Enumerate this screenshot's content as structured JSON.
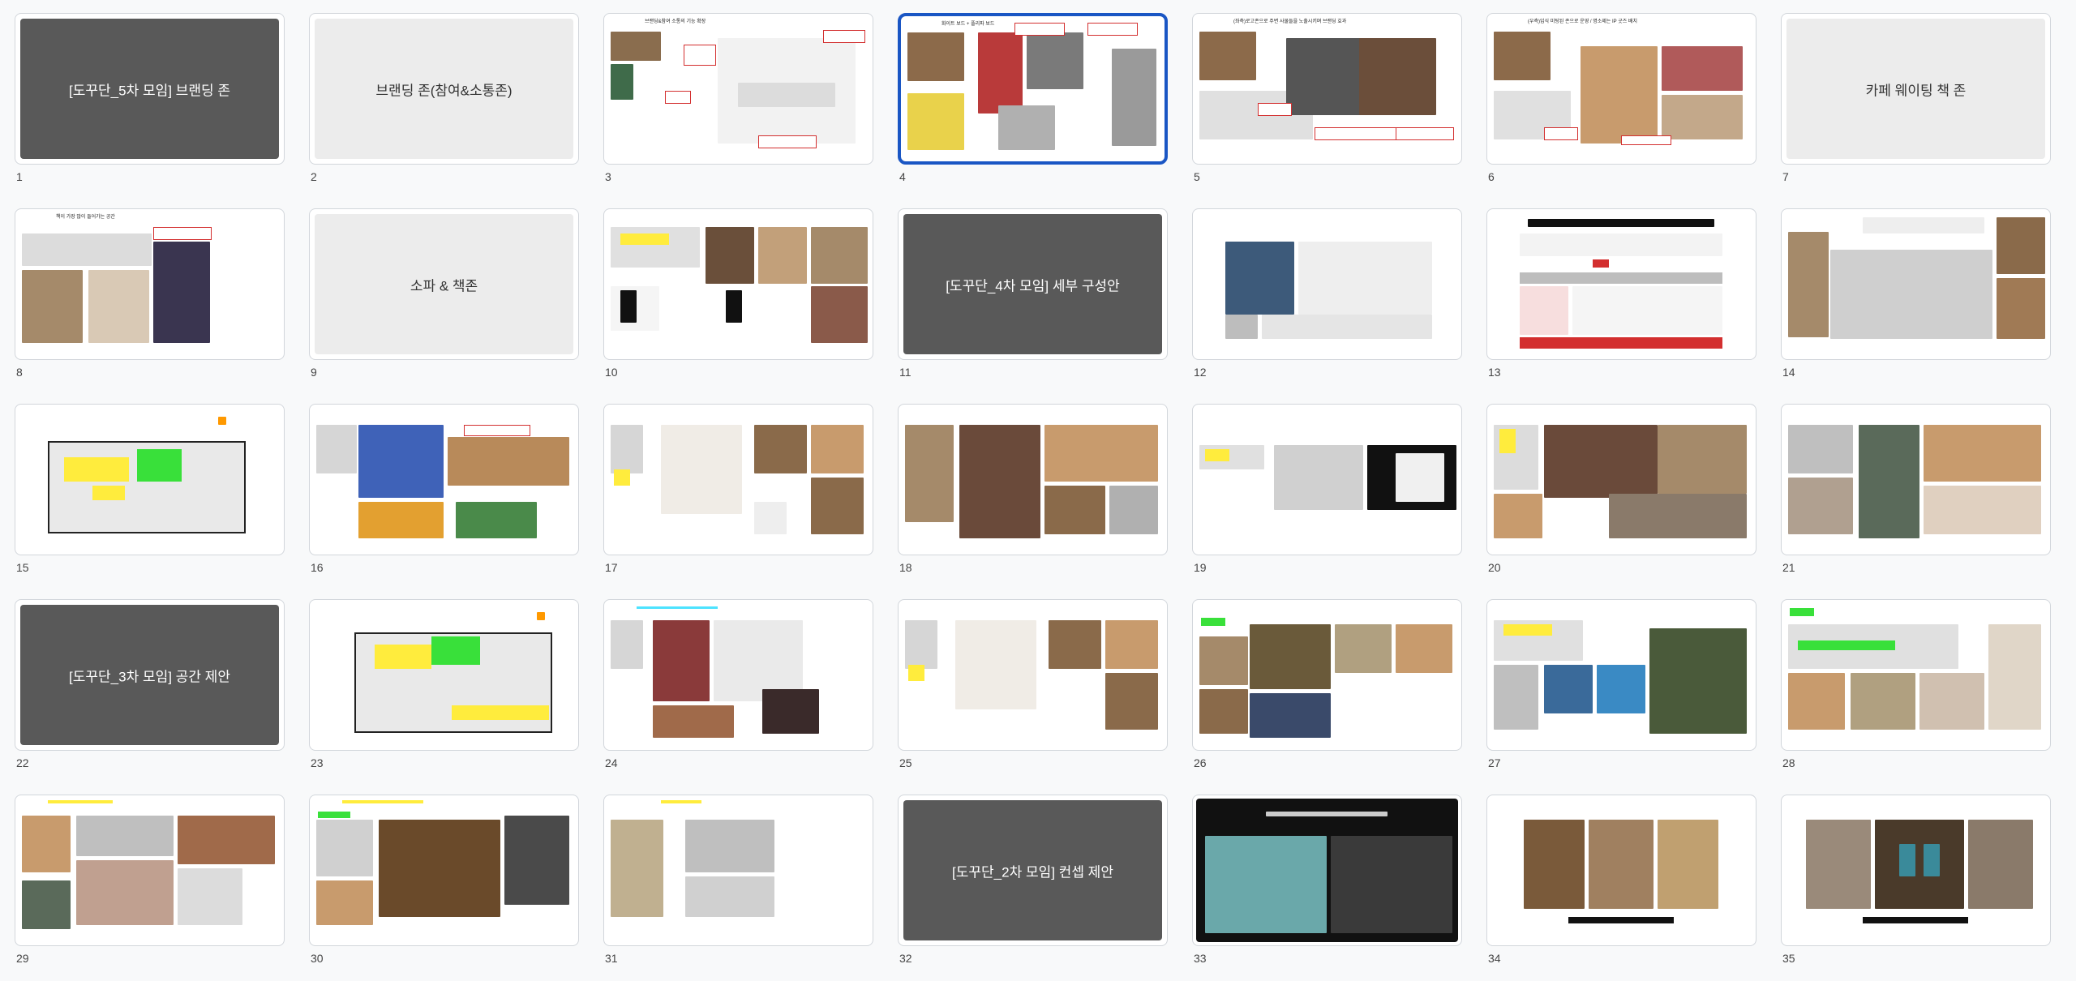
{
  "slides": [
    {
      "num": "1",
      "kind": "dark",
      "label": "[도꾸단_5차 모임] 브랜딩 존"
    },
    {
      "num": "2",
      "kind": "light",
      "label": "브랜딩 존(참여&소통존)"
    },
    {
      "num": "3",
      "kind": "content",
      "title": "브랜딩&참여 소통의 기능 확장"
    },
    {
      "num": "4",
      "kind": "content",
      "title": "화이트 보드 + 플리파 보드",
      "selected": true
    },
    {
      "num": "5",
      "kind": "content",
      "title": "(좌측)로고존으로 주변 사물들을 노출시키며 브랜딩 효과"
    },
    {
      "num": "6",
      "kind": "content",
      "title": "(우측)입식 미팅된 존으로 운영 / 명소제는 IP 굿즈 배치"
    },
    {
      "num": "7",
      "kind": "light",
      "label": "카페 웨이팅 책 존"
    },
    {
      "num": "8",
      "kind": "content",
      "title": "책이 가장 많이 들어가는 공간"
    },
    {
      "num": "9",
      "kind": "light",
      "label": "소파 & 책존"
    },
    {
      "num": "10",
      "kind": "content",
      "title": ""
    },
    {
      "num": "11",
      "kind": "dark",
      "label": "[도꾸단_4차 모임] 세부 구성안"
    },
    {
      "num": "12",
      "kind": "content",
      "title": ""
    },
    {
      "num": "13",
      "kind": "content",
      "title": ""
    },
    {
      "num": "14",
      "kind": "content",
      "title": ""
    },
    {
      "num": "15",
      "kind": "content",
      "title": ""
    },
    {
      "num": "16",
      "kind": "content",
      "title": ""
    },
    {
      "num": "17",
      "kind": "content",
      "title": ""
    },
    {
      "num": "18",
      "kind": "content",
      "title": ""
    },
    {
      "num": "19",
      "kind": "content",
      "title": ""
    },
    {
      "num": "20",
      "kind": "content",
      "title": ""
    },
    {
      "num": "21",
      "kind": "content",
      "title": ""
    },
    {
      "num": "22",
      "kind": "dark",
      "label": "[도꾸단_3차 모임] 공간 제안"
    },
    {
      "num": "23",
      "kind": "content",
      "title": ""
    },
    {
      "num": "24",
      "kind": "content",
      "title": ""
    },
    {
      "num": "25",
      "kind": "content",
      "title": ""
    },
    {
      "num": "26",
      "kind": "content",
      "title": ""
    },
    {
      "num": "27",
      "kind": "content",
      "title": ""
    },
    {
      "num": "28",
      "kind": "content",
      "title": ""
    },
    {
      "num": "29",
      "kind": "content",
      "title": ""
    },
    {
      "num": "30",
      "kind": "content",
      "title": ""
    },
    {
      "num": "31",
      "kind": "content",
      "title": ""
    },
    {
      "num": "32",
      "kind": "dark",
      "label": "[도꾸단_2차 모임] 컨셉 제안"
    },
    {
      "num": "33",
      "kind": "content",
      "title": ""
    },
    {
      "num": "34",
      "kind": "content",
      "title": ""
    },
    {
      "num": "35",
      "kind": "content",
      "title": ""
    }
  ],
  "colors": {
    "selection": "#1a56c4",
    "dark_slide": "#595959",
    "light_slide": "#ececec",
    "annotation": "#d32f2f",
    "highlight_yellow": "#ffec3d",
    "highlight_green": "#39e03a"
  }
}
